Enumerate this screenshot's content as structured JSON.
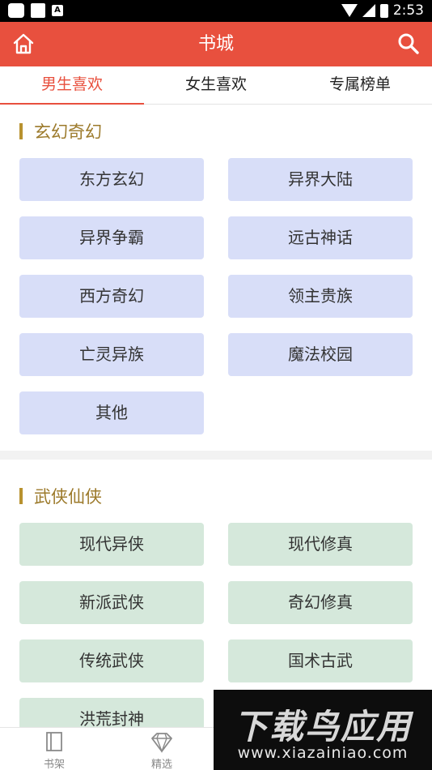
{
  "status_bar": {
    "time": "2:53",
    "badge": "A"
  },
  "app_bar": {
    "title": "书城",
    "home_icon": "home-icon",
    "search_icon": "search-icon",
    "color": "#e8503e"
  },
  "tabs": [
    {
      "label": "男生喜欢",
      "active": true
    },
    {
      "label": "女生喜欢",
      "active": false
    },
    {
      "label": "专属榜单",
      "active": false
    }
  ],
  "sections": [
    {
      "title": "玄幻奇幻",
      "items": [
        "东方玄幻",
        "异界大陆",
        "异界争霸",
        "远古神话",
        "西方奇幻",
        "领主贵族",
        "亡灵异族",
        "魔法校园",
        "其他"
      ]
    },
    {
      "title": "武侠仙侠",
      "items": [
        "现代异侠",
        "现代修真",
        "新派武侠",
        "奇幻修真",
        "传统武侠",
        "国术古武",
        "洪荒封神"
      ]
    }
  ],
  "bottom_nav": [
    {
      "label": "书架",
      "icon": "bookshelf-icon"
    },
    {
      "label": "精选",
      "icon": "diamond-icon"
    }
  ],
  "watermark": {
    "title": "下载鸟应用",
    "url": "www.xiazainiao.com"
  }
}
